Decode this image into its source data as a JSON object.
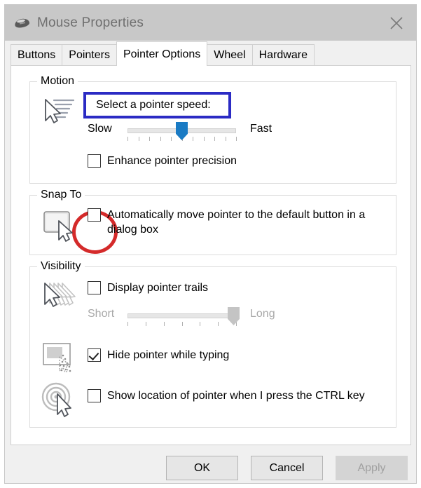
{
  "window": {
    "title": "Mouse Properties",
    "icon": "mouse-icon",
    "close_label": "✕"
  },
  "tabs": [
    {
      "label": "Buttons",
      "active": false
    },
    {
      "label": "Pointers",
      "active": false
    },
    {
      "label": "Pointer Options",
      "active": true
    },
    {
      "label": "Wheel",
      "active": false
    },
    {
      "label": "Hardware",
      "active": false
    }
  ],
  "motion": {
    "legend": "Motion",
    "icon": "pointer-speed-icon",
    "speed_label": "Select a pointer speed:",
    "slider": {
      "min_label": "Slow",
      "max_label": "Fast",
      "value": 6,
      "ticks": 11,
      "enabled": true
    },
    "enhance_precision": {
      "label": "Enhance pointer precision",
      "checked": false
    }
  },
  "snap_to": {
    "legend": "Snap To",
    "icon": "default-button-icon",
    "auto_move": {
      "label": "Automatically move pointer to the default button in a dialog box",
      "checked": false
    }
  },
  "visibility": {
    "legend": "Visibility",
    "trails": {
      "icon": "pointer-trails-icon",
      "label": "Display pointer trails",
      "checked": false,
      "slider": {
        "min_label": "Short",
        "max_label": "Long",
        "value": 9,
        "ticks": 7,
        "enabled": false
      }
    },
    "hide_while_typing": {
      "icon": "hide-pointer-icon",
      "label": "Hide pointer while typing",
      "checked": true
    },
    "show_location": {
      "icon": "locate-pointer-icon",
      "label": "Show location of pointer when I press the CTRL key",
      "checked": false
    }
  },
  "buttons": {
    "ok": "OK",
    "cancel": "Cancel",
    "apply": "Apply",
    "apply_enabled": false
  },
  "annotations": {
    "highlight_box_color": "#2b2bc4",
    "circle_color": "#d42a2a"
  }
}
